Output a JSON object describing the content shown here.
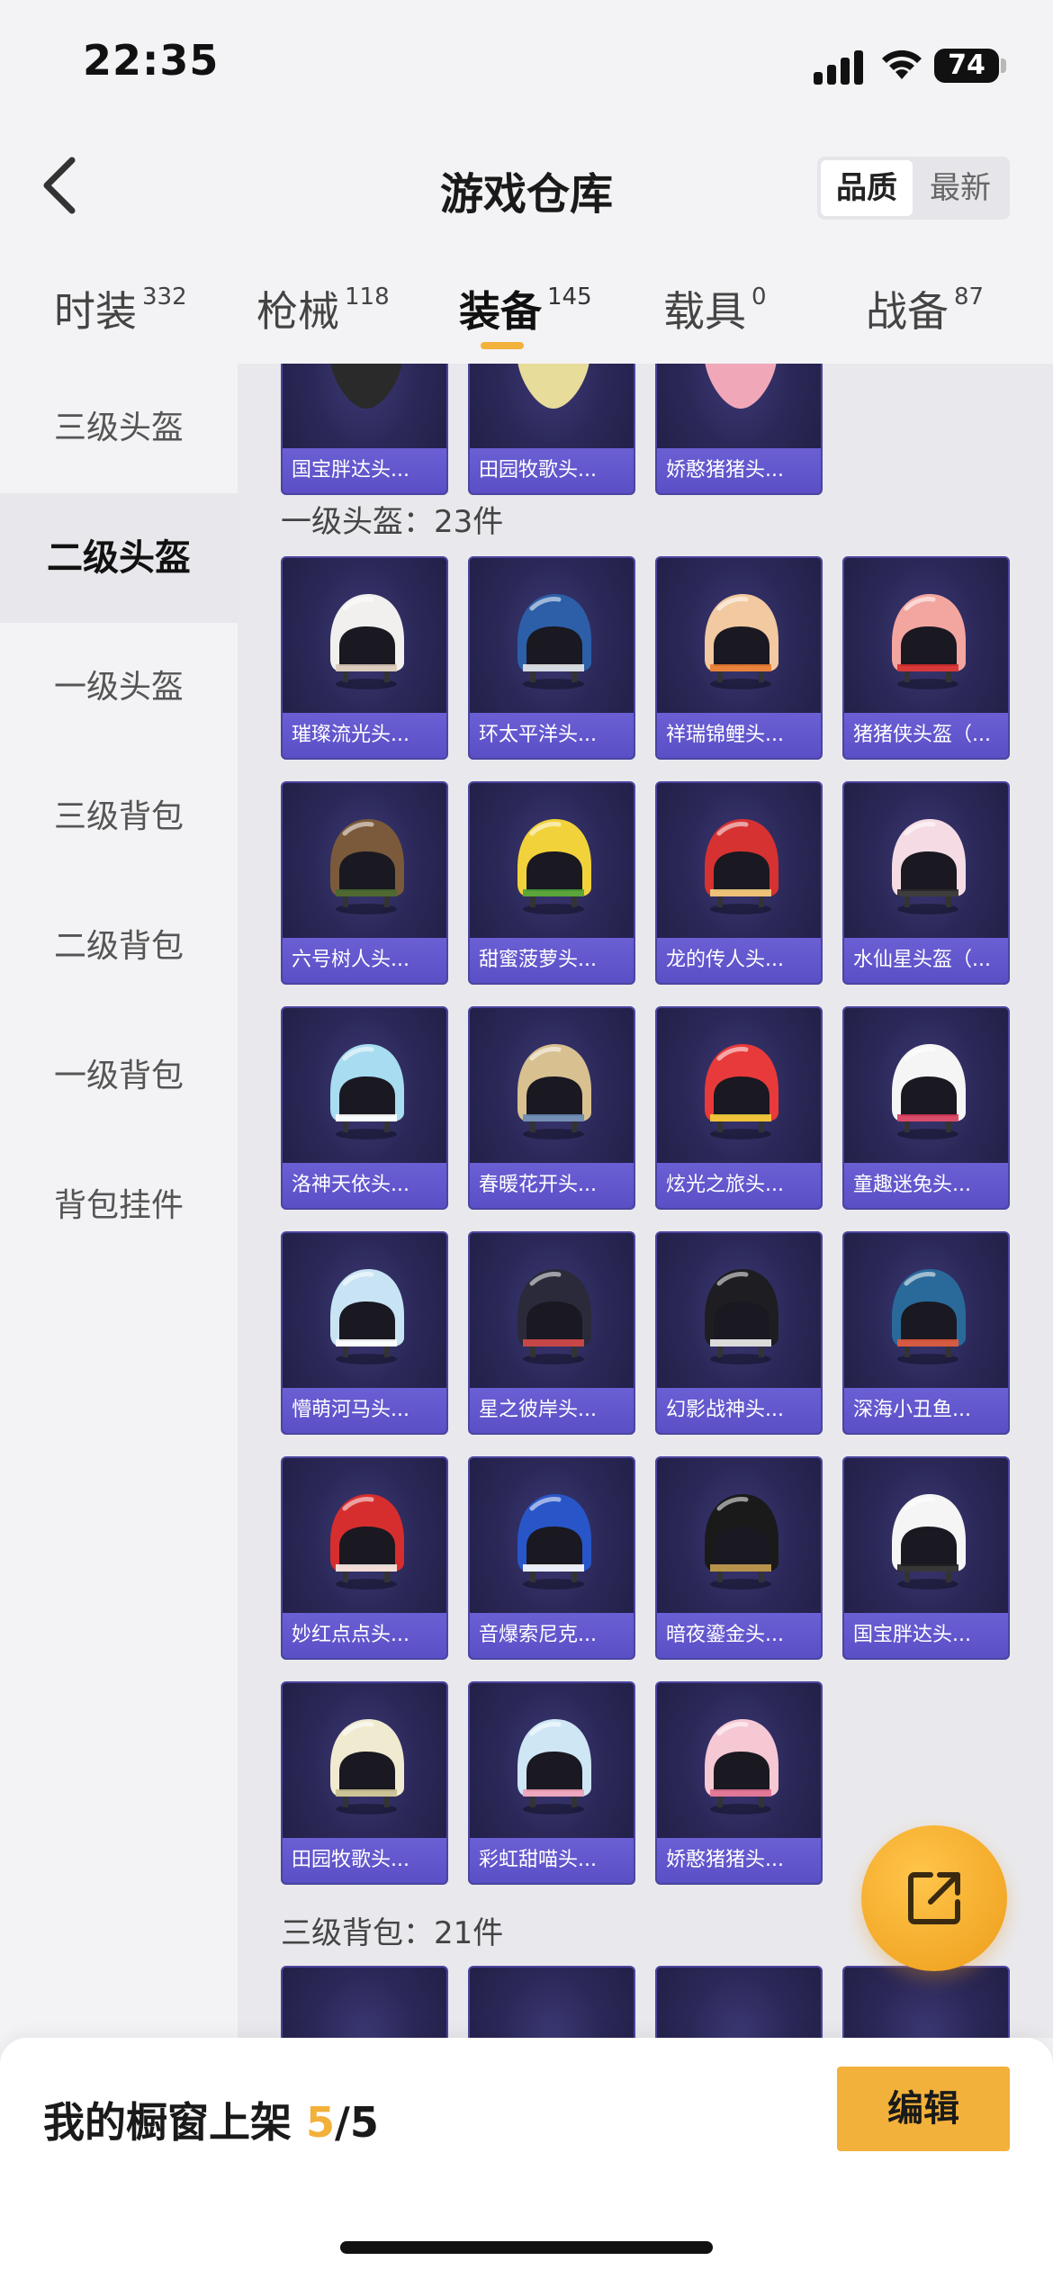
{
  "status": {
    "time": "22:35",
    "battery": "74"
  },
  "header": {
    "title": "游戏仓库",
    "sort_options": [
      "品质",
      "最新"
    ],
    "active_sort": "品质"
  },
  "tabs": [
    {
      "label": "时装",
      "count": "332"
    },
    {
      "label": "枪械",
      "count": "118"
    },
    {
      "label": "装备",
      "count": "145"
    },
    {
      "label": "载具",
      "count": "0"
    },
    {
      "label": "战备",
      "count": "87"
    }
  ],
  "active_tab": "装备",
  "sidebar": {
    "items": [
      "三级头盔",
      "二级头盔",
      "一级头盔",
      "三级背包",
      "二级背包",
      "一级背包",
      "背包挂件"
    ],
    "active": "二级头盔"
  },
  "top_partial_row": [
    {
      "name": "国宝胖达头...",
      "color": "#2a2a2a",
      "icon": "panda-helmet-icon"
    },
    {
      "name": "田园牧歌头...",
      "color": "#e8dc9a",
      "icon": "cow-helmet-icon"
    },
    {
      "name": "娇憨猪猪头...",
      "color": "#f0a8b8",
      "icon": "pig-helmet-icon"
    }
  ],
  "section_level1": {
    "title": "一级头盔：23件",
    "items": [
      {
        "name": "璀璨流光头...",
        "color": "#f2f0ee",
        "accent": "#d8c8b8"
      },
      {
        "name": "环太平洋头...",
        "color": "#2c5fa8",
        "accent": "#e8e8e8"
      },
      {
        "name": "祥瑞锦鲤头...",
        "color": "#f2c9a0",
        "accent": "#e87a30"
      },
      {
        "name": "猪猪侠头盔（...",
        "color": "#f3a6a0",
        "accent": "#d62e2e"
      },
      {
        "name": "六号树人头...",
        "color": "#7a5a3a",
        "accent": "#4a6a30"
      },
      {
        "name": "甜蜜菠萝头...",
        "color": "#f2d23a",
        "accent": "#4aa03a"
      },
      {
        "name": "龙的传人头...",
        "color": "#d63232",
        "accent": "#f0d080"
      },
      {
        "name": "水仙星头盔（...",
        "color": "#f5dce4",
        "accent": "#2a2a2a"
      },
      {
        "name": "洛神天依头...",
        "color": "#a8dcf0",
        "accent": "#ffffff"
      },
      {
        "name": "春暖花开头...",
        "color": "#d8c090",
        "accent": "#6a8ab8"
      },
      {
        "name": "炫光之旅头...",
        "color": "#e83a3a",
        "accent": "#f2d23a"
      },
      {
        "name": "童趣迷兔头...",
        "color": "#f5f5f5",
        "accent": "#d63a5a"
      },
      {
        "name": "懵萌河马头...",
        "color": "#c8e4f4",
        "accent": "#ffffff"
      },
      {
        "name": "星之彼岸头...",
        "color": "#2a2a3a",
        "accent": "#d84a4a"
      },
      {
        "name": "幻影战神头...",
        "color": "#1e1e22",
        "accent": "#f0f0f0"
      },
      {
        "name": "深海小丑鱼...",
        "color": "#2a6a9a",
        "accent": "#e85a3a"
      },
      {
        "name": "妙红点点头...",
        "color": "#d62e2e",
        "accent": "#f5f0e8"
      },
      {
        "name": "音爆索尼克...",
        "color": "#2856c8",
        "accent": "#ffffff"
      },
      {
        "name": "暗夜鎏金头...",
        "color": "#1a1a1a",
        "accent": "#c8a050"
      },
      {
        "name": "国宝胖达头...",
        "color": "#f5f5f5",
        "accent": "#222222"
      },
      {
        "name": "田园牧歌头...",
        "color": "#f0ead0",
        "accent": "#c8c090"
      },
      {
        "name": "彩虹甜喵头...",
        "color": "#cfe6f5",
        "accent": "#f0a0b8"
      },
      {
        "name": "娇憨猪猪头...",
        "color": "#f5c8d4",
        "accent": "#e07090"
      }
    ]
  },
  "section_level3_backpack": {
    "title": "三级背包：21件"
  },
  "bottom_bar": {
    "shelf_prefix": "我的橱窗上架 ",
    "shelf_used": "5",
    "shelf_total": "/5",
    "edit_label": "编辑"
  },
  "colors": {
    "accent": "#f2b13a",
    "card_bg": "#2b2858",
    "card_label": "#5a4fc6"
  }
}
